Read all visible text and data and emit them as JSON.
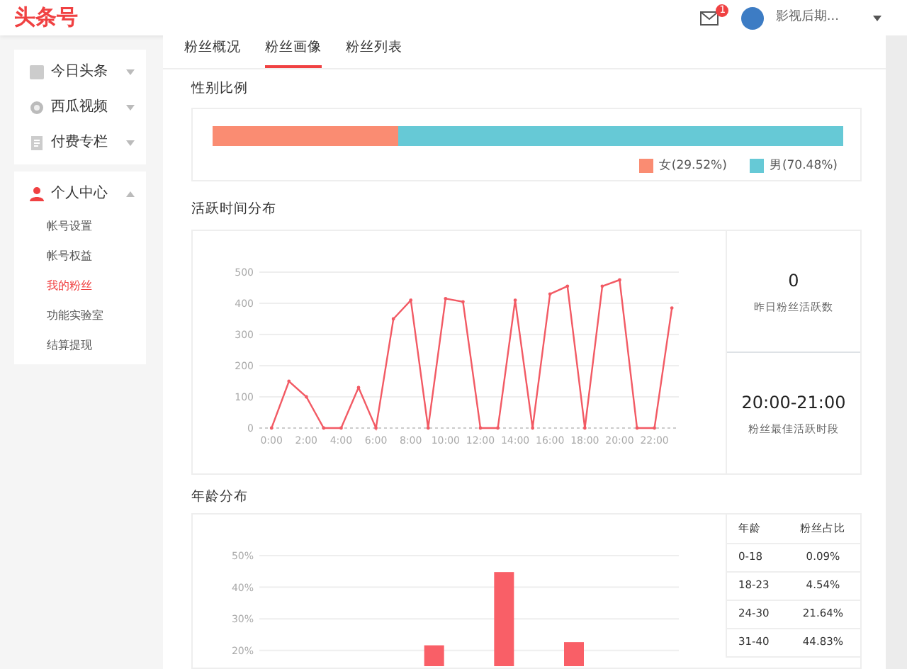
{
  "header": {
    "logo": "头条号",
    "mail_badge": "1",
    "user_name": "影视后期..."
  },
  "sidebar": {
    "groups": [
      {
        "items": [
          {
            "label": "今日头条",
            "kind": "square",
            "expanded": false
          },
          {
            "label": "西瓜视频",
            "kind": "circle",
            "expanded": false
          },
          {
            "label": "付费专栏",
            "kind": "doc",
            "expanded": false
          }
        ]
      },
      {
        "items": [
          {
            "label": "个人中心",
            "kind": "person",
            "expanded": true,
            "children": [
              {
                "label": "帐号设置",
                "selected": false
              },
              {
                "label": "帐号权益",
                "selected": false
              },
              {
                "label": "我的粉丝",
                "selected": true
              },
              {
                "label": "功能实验室",
                "selected": false
              },
              {
                "label": "结算提现",
                "selected": false
              }
            ]
          }
        ]
      }
    ]
  },
  "tabs": [
    {
      "label": "粉丝概况",
      "selected": false
    },
    {
      "label": "粉丝画像",
      "selected": true
    },
    {
      "label": "粉丝列表",
      "selected": false
    }
  ],
  "gender": {
    "title": "性别比例",
    "segments": [
      {
        "label": "女(29.52%)",
        "level": 0.2952,
        "color": "#fa8c72"
      },
      {
        "label": "男(70.48%)",
        "level": 0.7048,
        "color": "#66c9d6"
      }
    ]
  },
  "activity": {
    "title": "活跃时间分布",
    "chart_data": {
      "type": "line",
      "x": [
        0,
        1,
        2,
        3,
        4,
        5,
        6,
        7,
        8,
        9,
        10,
        11,
        12,
        13,
        14,
        15,
        16,
        17,
        18,
        19,
        20,
        21,
        22,
        23
      ],
      "series": [
        {
          "color": "#f25a64",
          "values": [
            0,
            150,
            100,
            0,
            0,
            130,
            0,
            350,
            410,
            0,
            415,
            405,
            0,
            0,
            410,
            0,
            430,
            455,
            0,
            455,
            475,
            0,
            0,
            385
          ]
        }
      ],
      "xlim": [
        -0.7,
        23.4
      ],
      "ylim": [
        0,
        500
      ],
      "grid": true,
      "yticks": [
        0,
        100,
        200,
        300,
        400,
        500
      ],
      "xticks": [
        {
          "value": 0,
          "label": "0:00"
        },
        {
          "value": 2,
          "label": "2:00"
        },
        {
          "value": 4,
          "label": "4:00"
        },
        {
          "value": 6,
          "label": "6:00"
        },
        {
          "value": 8,
          "label": "8:00"
        },
        {
          "value": 10,
          "label": "10:00"
        },
        {
          "value": 12,
          "label": "12:00"
        },
        {
          "value": 14,
          "label": "14:00"
        },
        {
          "value": 16,
          "label": "16:00"
        },
        {
          "value": 18,
          "label": "18:00"
        },
        {
          "value": 20,
          "label": "20:00"
        },
        {
          "value": 22,
          "label": "22:00"
        }
      ]
    },
    "stats": [
      {
        "value": "0",
        "label": "昨日粉丝活跃数"
      },
      {
        "value": "20:00-21:00",
        "label": "粉丝最佳活跃时段"
      }
    ]
  },
  "age": {
    "title": "年龄分布",
    "chart_data": {
      "type": "bar",
      "series": [
        {
          "color": "#f95f67",
          "values": [
            null,
            null,
            21.6,
            44.8,
            22.6,
            null
          ]
        }
      ],
      "ylim": [
        15,
        50
      ],
      "grid": true,
      "yticks": [
        {
          "value": 20,
          "label": "20%"
        },
        {
          "value": 30,
          "label": "30%"
        },
        {
          "value": 40,
          "label": "40%"
        },
        {
          "value": 50,
          "label": "50%"
        }
      ]
    },
    "table": {
      "columns": [
        "年龄",
        "粉丝占比"
      ],
      "rows": [
        [
          "0-18",
          "0.09%"
        ],
        [
          "18-23",
          "4.54%"
        ],
        [
          "24-30",
          "21.64%"
        ],
        [
          "31-40",
          "44.83%"
        ]
      ]
    }
  }
}
